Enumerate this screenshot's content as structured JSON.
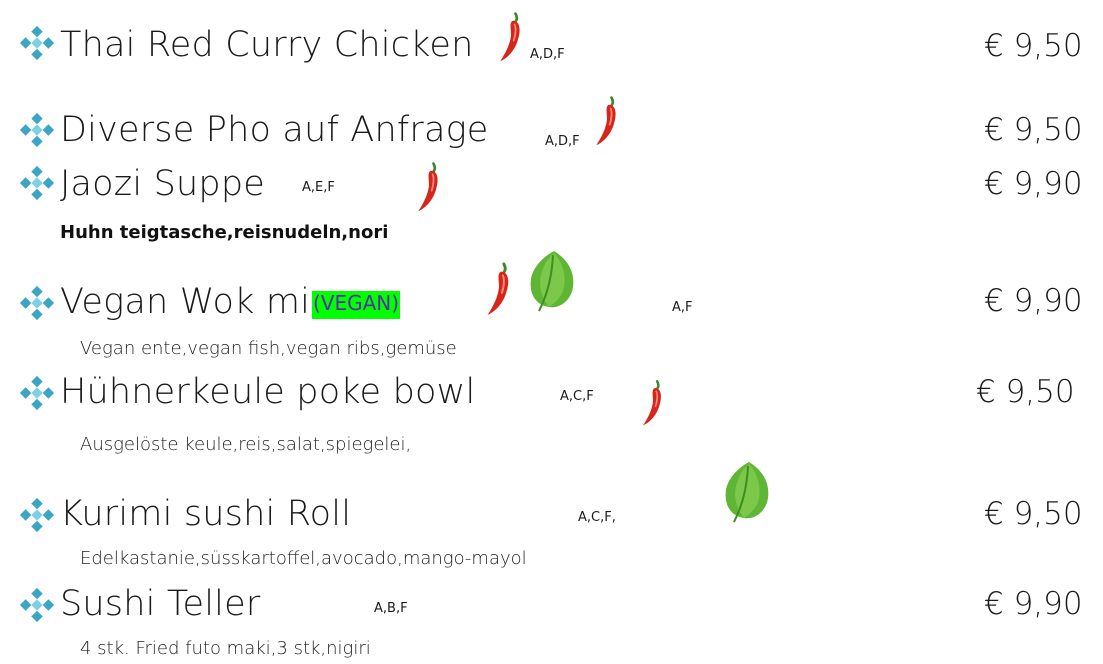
{
  "menu": {
    "items": [
      {
        "name": "Thai Red Curry Chicken",
        "allergens": "A,D,F",
        "price": "€ 9,50",
        "description": "",
        "chili": true,
        "leaf": false
      },
      {
        "name": "Diverse Pho auf Anfrage",
        "allergens": "A,D,F",
        "price": "€ 9,50",
        "description": "",
        "chili": true,
        "leaf": false
      },
      {
        "name": "Jaozi  Suppe",
        "allergens": "A,E,F",
        "price": "€ 9,90",
        "description": "Huhn teigtasche,reisnudeln,nori",
        "chili": true,
        "leaf": false
      },
      {
        "name": "Vegan Wok mix",
        "tag": "(VEGAN)",
        "allergens": "A,F",
        "price": "€ 9,90",
        "description": "Vegan ente,vegan fish,vegan ribs,gemüse",
        "chili": true,
        "leaf": true
      },
      {
        "name": "Hühnerkeule poke bowl",
        "allergens": "A,C,F",
        "price": "€ 9,50",
        "description": "Ausgelöste keule,reis,salat,spiegelei,",
        "chili": true,
        "leaf": false
      },
      {
        "name": "Kurimi sushi  Roll",
        "allergens": "A,C,F,",
        "price": "€ 9,50",
        "description": "Edelkastanie,süsskartoffel,avocado,mango-mayol",
        "chili": false,
        "leaf": true
      },
      {
        "name": "Sushi Teller",
        "allergens": "A,B,F",
        "price": "€ 9,90",
        "description": "4 stk. Fried futo maki,3 stk,nigiri",
        "chili": false,
        "leaf": false
      }
    ]
  },
  "colors": {
    "bullet": "#3aa6c4",
    "bullet_center": "#7fd0e6",
    "chili": "#d6261c",
    "chili_stem": "#3a8a2a",
    "leaf": "#5fb534",
    "vegan_highlight": "#00ff00",
    "vegan_text": "#5a2ea6"
  },
  "icons": [
    "diamond-bullet-icon",
    "chili-pepper-icon",
    "leaf-icon"
  ]
}
